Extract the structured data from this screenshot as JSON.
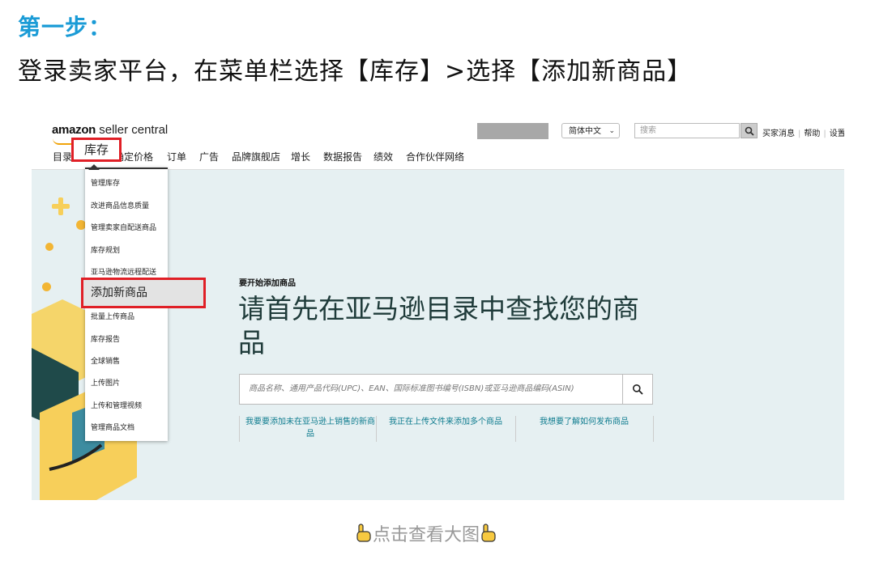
{
  "article": {
    "step_title": "第一步：",
    "instruction": "登录卖家平台，在菜单栏选择【库存】>选择【添加新商品】",
    "footer_text": "点击查看大图"
  },
  "header": {
    "logo_brand": "amazon",
    "logo_product": " seller central",
    "language": "简体中文",
    "search_placeholder": "搜索",
    "links": [
      "买家消息",
      "帮助",
      "设置"
    ]
  },
  "nav": {
    "items": [
      "目录",
      "库存",
      "确定价格",
      "订单",
      "广告",
      "品牌旗舰店",
      "增长",
      "数据报告",
      "绩效",
      "合作伙伴网络"
    ]
  },
  "inventory_menu": {
    "items": [
      "管理库存",
      "改进商品信息质量",
      "管理卖家自配送商品",
      "库存规划",
      "亚马逊物流远程配送",
      "添加新商品",
      "批量上传商品",
      "库存报告",
      "全球销售",
      "上传图片",
      "上传和管理视频",
      "管理商品文档"
    ],
    "highlighted": "添加新商品"
  },
  "main": {
    "label": "要开始添加商品",
    "title": "请首先在亚马逊目录中查找您的商品",
    "search_placeholder": "商品名称、通用产品代码(UPC)、EAN、国际标准图书编号(ISBN)或亚马逊商品编码(ASIN)",
    "links": [
      "我要要添加未在亚马逊上销售的新商品",
      "我正在上传文件来添加多个商品",
      "我想要了解如何发布商品"
    ]
  },
  "colors": {
    "step_title": "#1a9bd6",
    "highlight_border": "#e01f26",
    "main_bg": "#e6f0f2",
    "link": "#0f7c8f",
    "accent_yellow": "#f2b534"
  }
}
